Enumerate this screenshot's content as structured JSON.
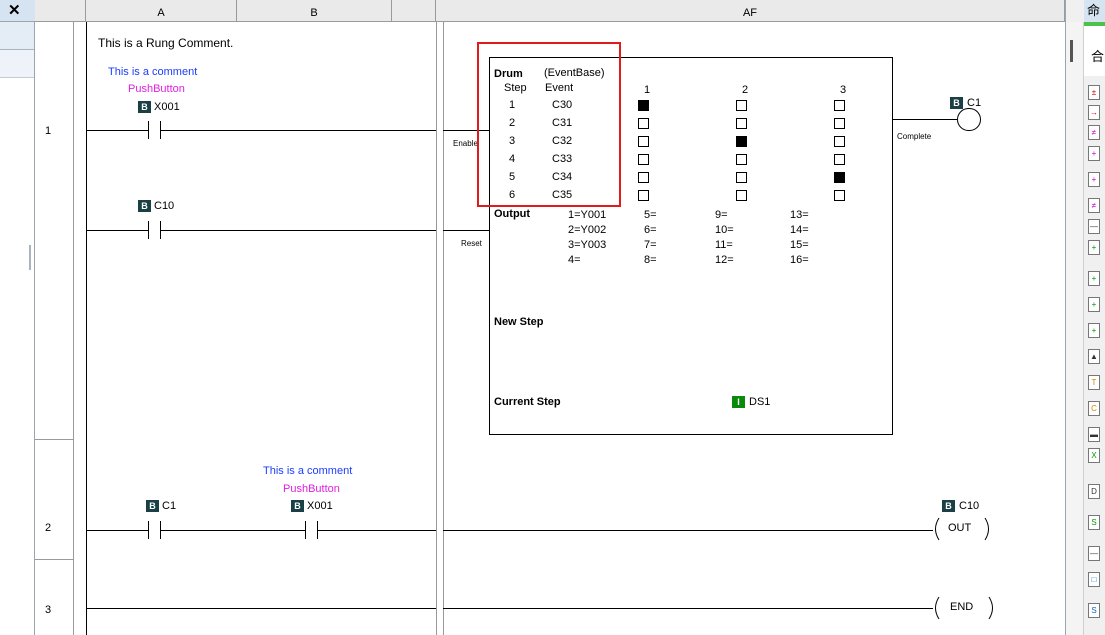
{
  "columns": {
    "a": "A",
    "b": "B",
    "af": "AF"
  },
  "rows": [
    "1",
    "2",
    "3"
  ],
  "rung1": {
    "rung_comment": "This is a Rung Comment.",
    "contact1": {
      "comment": "This is a comment",
      "nickname": "PushButton",
      "address": "X001"
    },
    "contact2": {
      "address": "C10"
    },
    "enable_label": "Enable",
    "reset_label": "Reset",
    "complete_label": "Complete",
    "coil": {
      "address": "C1"
    }
  },
  "drum": {
    "title": "Drum",
    "type": "(EventBase)",
    "step_header": "Step",
    "event_header": "Event",
    "output_columns": [
      "1",
      "2",
      "3"
    ],
    "steps": [
      {
        "step": "1",
        "event": "C30",
        "outputs": [
          1,
          0,
          0
        ]
      },
      {
        "step": "2",
        "event": "C31",
        "outputs": [
          0,
          0,
          0
        ]
      },
      {
        "step": "3",
        "event": "C32",
        "outputs": [
          0,
          1,
          0
        ]
      },
      {
        "step": "4",
        "event": "C33",
        "outputs": [
          0,
          0,
          0
        ]
      },
      {
        "step": "5",
        "event": "C34",
        "outputs": [
          0,
          0,
          1
        ]
      },
      {
        "step": "6",
        "event": "C35",
        "outputs": [
          0,
          0,
          0
        ]
      }
    ],
    "output_label": "Output",
    "output_map": [
      [
        "1=Y001",
        "5=",
        "9=",
        "13="
      ],
      [
        "2=Y002",
        "6=",
        "10=",
        "14="
      ],
      [
        "3=Y003",
        "7=",
        "11=",
        "15="
      ],
      [
        "4=",
        "8=",
        "12=",
        "16="
      ]
    ],
    "new_step_label": "New Step",
    "current_step_label": "Current Step",
    "current_step_address": "DS1"
  },
  "rung2": {
    "contact1": {
      "address": "C1"
    },
    "contact2": {
      "comment": "This is a comment",
      "nickname": "PushButton",
      "address": "X001"
    },
    "coil": {
      "address": "C10",
      "instruction": "OUT"
    }
  },
  "rung3": {
    "coil": {
      "instruction": "END"
    }
  },
  "right_panel": {
    "header_glyph": "命",
    "sub_glyph": "合"
  },
  "colors": {
    "highlight": "#e01b1b",
    "contact_icon": "#1a3f45",
    "register_icon": "#0a8a0a",
    "comment_blue": "#1a3cff",
    "nickname_magenta": "#e020e0"
  }
}
